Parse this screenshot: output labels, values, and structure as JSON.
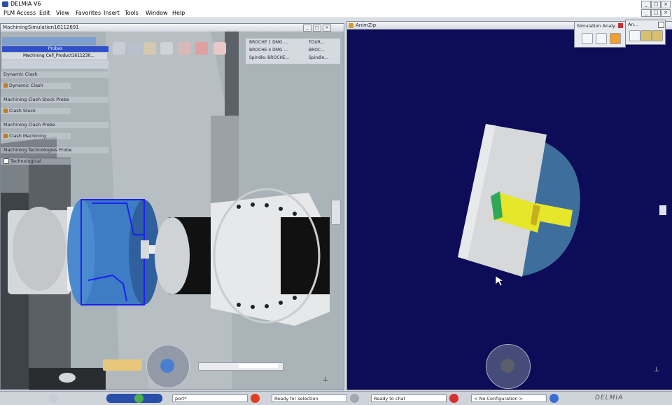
{
  "app": {
    "title": "DELMIA V6"
  },
  "menu": [
    "PLM Access",
    "Edit",
    "View",
    "Favorites",
    "Insert",
    "Tools",
    "Window",
    "Help"
  ],
  "left_window": {
    "title": "MachiningSimulation16112691",
    "toolbar_label": "Probes",
    "tree_root": "Machining Cell_Product1611230...",
    "tree": [
      "Dynamic Clash",
      "Dynamic Clash",
      "Machining Clash Stock Probe",
      "Clash Stock",
      "Machining Clash Probe",
      "Clash Machining",
      "Machining Technologies Probe",
      "Technological"
    ],
    "objects": [
      "BROCHE 1 DMG ...",
      "BROCHE 4 DMG ...",
      "Spindle: BROCHE...",
      "TOUR...",
      "BROC...",
      "Spindle..."
    ]
  },
  "right_window": {
    "title": "AnimZip"
  },
  "sim_panel": {
    "title": "Simulation Analy..."
  },
  "an_panel": {
    "title": "An..."
  },
  "status": {
    "command_value": "port*",
    "selection": "Ready for selection",
    "chat": "Ready to chat",
    "configuration": "< No Configuration >",
    "brand": "DELMIA"
  },
  "colors": {
    "right_bg": "#0c0c58",
    "part_grey": "#d4d6d8",
    "part_blue": "#3e6f9c",
    "tool_yellow": "#e8e82a",
    "tool_green": "#3bb35a",
    "highlight_blue": "#2233ee"
  }
}
